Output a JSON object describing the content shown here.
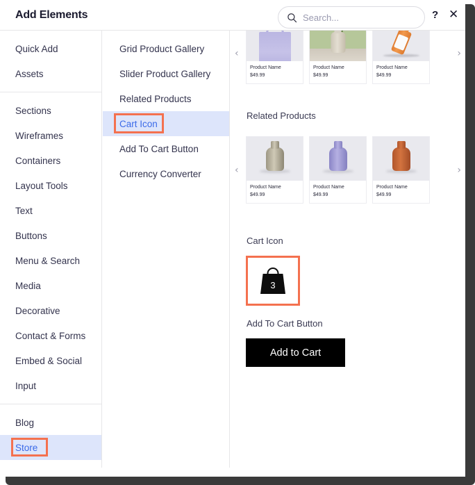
{
  "header": {
    "title": "Add Elements",
    "search_placeholder": "Search...",
    "search_value": "",
    "help_label": "?",
    "close_label": "✕"
  },
  "sidebar": {
    "groups": [
      {
        "items": [
          {
            "label": "Quick Add",
            "selected": false
          },
          {
            "label": "Assets",
            "selected": false
          }
        ]
      },
      {
        "items": [
          {
            "label": "Sections",
            "selected": false
          },
          {
            "label": "Wireframes",
            "selected": false
          },
          {
            "label": "Containers",
            "selected": false
          },
          {
            "label": "Layout Tools",
            "selected": false
          },
          {
            "label": "Text",
            "selected": false
          },
          {
            "label": "Buttons",
            "selected": false
          },
          {
            "label": "Menu & Search",
            "selected": false
          },
          {
            "label": "Media",
            "selected": false
          },
          {
            "label": "Decorative",
            "selected": false
          },
          {
            "label": "Contact & Forms",
            "selected": false
          },
          {
            "label": "Embed & Social",
            "selected": false
          },
          {
            "label": "Input",
            "selected": false
          }
        ]
      },
      {
        "items": [
          {
            "label": "Blog",
            "selected": false
          },
          {
            "label": "Store",
            "selected": true,
            "annotated": true
          }
        ]
      }
    ]
  },
  "sublist": {
    "items": [
      {
        "label": "Grid Product Gallery",
        "selected": false
      },
      {
        "label": "Slider Product Gallery",
        "selected": false
      },
      {
        "label": "Related Products",
        "selected": false
      },
      {
        "label": "Cart Icon",
        "selected": true,
        "annotated": true
      },
      {
        "label": "Add To Cart Button",
        "selected": false
      },
      {
        "label": "Currency Converter",
        "selected": false
      }
    ]
  },
  "preview": {
    "top_carousel": {
      "prev_label": "‹",
      "next_label": "›",
      "cards": [
        {
          "name": "Product Name",
          "price": "$49.99",
          "art": "tote-bag"
        },
        {
          "name": "Product Name",
          "price": "$49.99",
          "art": "vase-green"
        },
        {
          "name": "Product Name",
          "price": "$49.99",
          "art": "dropper-bottle"
        }
      ]
    },
    "related_products": {
      "title": "Related Products",
      "prev_label": "‹",
      "next_label": "›",
      "cards": [
        {
          "name": "Product Name",
          "price": "$49.99",
          "art": "vase-beige"
        },
        {
          "name": "Product Name",
          "price": "$49.99",
          "art": "vase-lavender"
        },
        {
          "name": "Product Name",
          "price": "$49.99",
          "art": "vase-terracotta"
        }
      ]
    },
    "cart_icon_section": {
      "title": "Cart Icon",
      "badge_count": "3"
    },
    "add_to_cart_section": {
      "title": "Add To Cart Button",
      "button_label": "Add to Cart"
    }
  },
  "colors": {
    "accent_blue": "#3b6ae8",
    "selected_bg": "#dde5fb",
    "annotation": "#f4714f",
    "button_black": "#000000"
  }
}
